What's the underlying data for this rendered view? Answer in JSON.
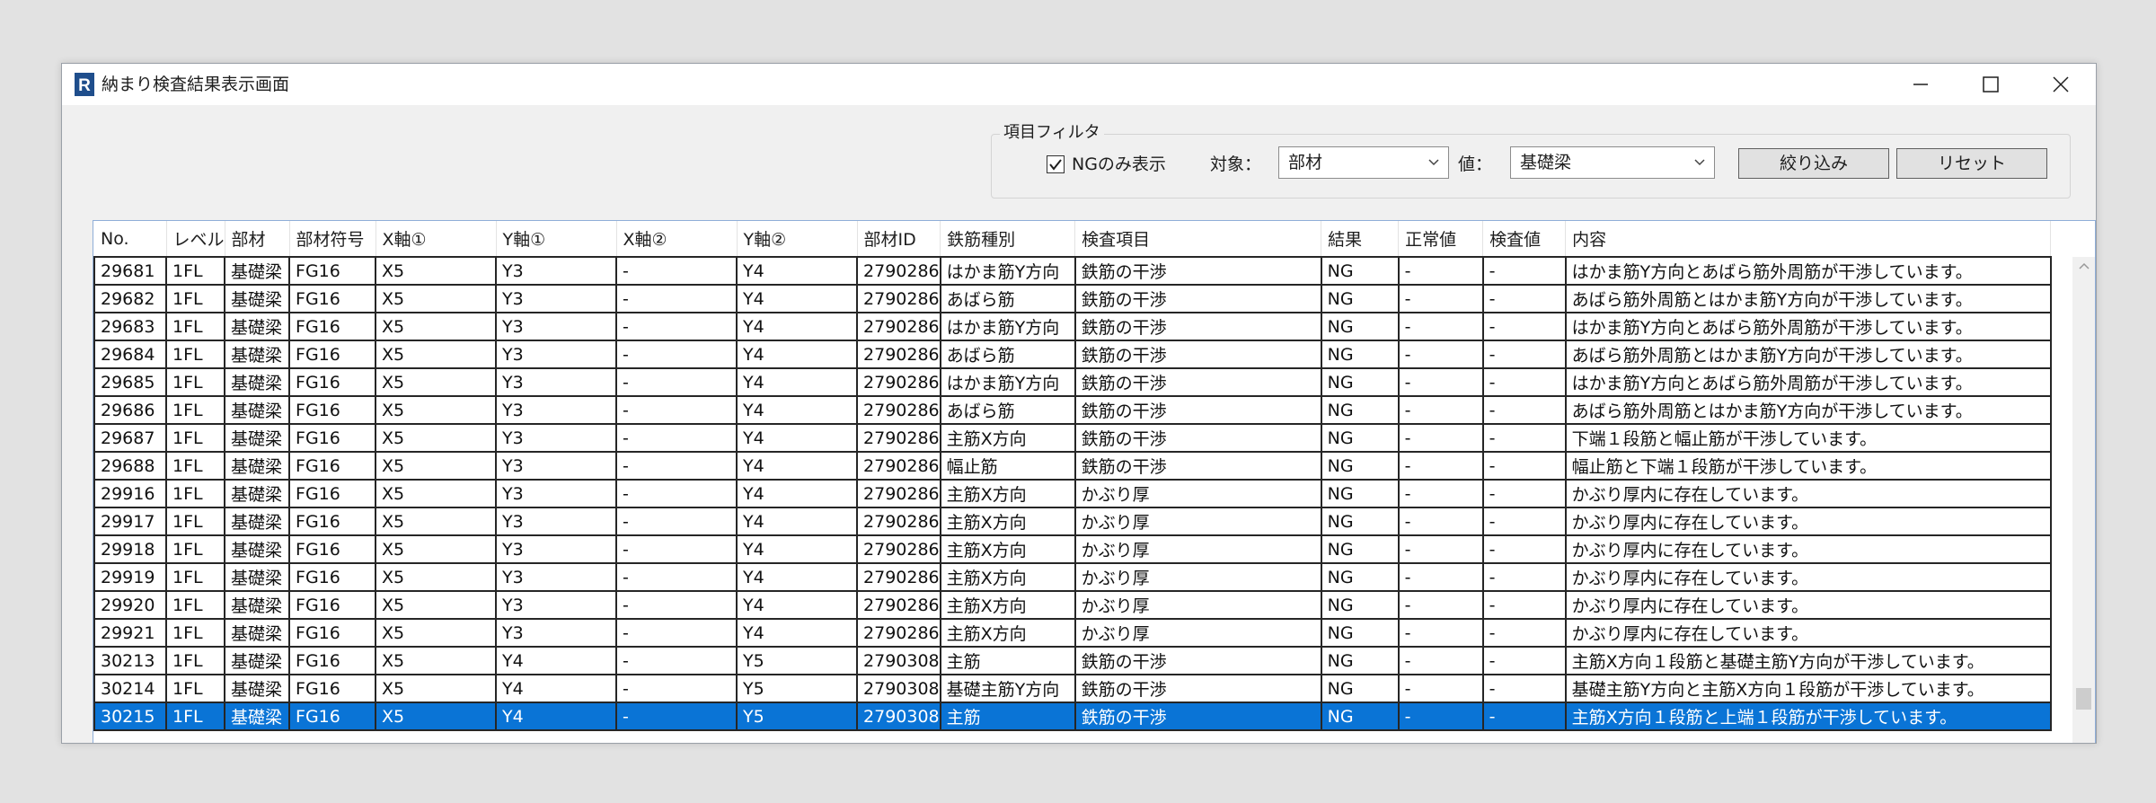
{
  "window": {
    "title": "納まり検査結果表示画面"
  },
  "filter": {
    "legend": "項目フィルタ",
    "ng_only_label": "NGのみ表示",
    "ng_only_checked": true,
    "target_label": "対象：",
    "target_value": "部材",
    "value_label": "値：",
    "value_value": "基礎梁",
    "apply_label": "絞り込み",
    "reset_label": "リセット"
  },
  "table": {
    "columns": [
      "No.",
      "レベル",
      "部材",
      "部材符号",
      "X軸①",
      "Y軸①",
      "X軸②",
      "Y軸②",
      "部材ID",
      "鉄筋種別",
      "検査項目",
      "結果",
      "正常値",
      "検査値",
      "内容"
    ],
    "rows": [
      [
        "29681",
        "1FL",
        "基礎梁",
        "FG16",
        "X5",
        "Y3",
        "-",
        "Y4",
        "2790286",
        "はかま筋Y方向",
        "鉄筋の干渉",
        "NG",
        "-",
        "-",
        "はかま筋Y方向とあばら筋外周筋が干渉しています。"
      ],
      [
        "29682",
        "1FL",
        "基礎梁",
        "FG16",
        "X5",
        "Y3",
        "-",
        "Y4",
        "2790286",
        "あばら筋",
        "鉄筋の干渉",
        "NG",
        "-",
        "-",
        "あばら筋外周筋とはかま筋Y方向が干渉しています。"
      ],
      [
        "29683",
        "1FL",
        "基礎梁",
        "FG16",
        "X5",
        "Y3",
        "-",
        "Y4",
        "2790286",
        "はかま筋Y方向",
        "鉄筋の干渉",
        "NG",
        "-",
        "-",
        "はかま筋Y方向とあばら筋外周筋が干渉しています。"
      ],
      [
        "29684",
        "1FL",
        "基礎梁",
        "FG16",
        "X5",
        "Y3",
        "-",
        "Y4",
        "2790286",
        "あばら筋",
        "鉄筋の干渉",
        "NG",
        "-",
        "-",
        "あばら筋外周筋とはかま筋Y方向が干渉しています。"
      ],
      [
        "29685",
        "1FL",
        "基礎梁",
        "FG16",
        "X5",
        "Y3",
        "-",
        "Y4",
        "2790286",
        "はかま筋Y方向",
        "鉄筋の干渉",
        "NG",
        "-",
        "-",
        "はかま筋Y方向とあばら筋外周筋が干渉しています。"
      ],
      [
        "29686",
        "1FL",
        "基礎梁",
        "FG16",
        "X5",
        "Y3",
        "-",
        "Y4",
        "2790286",
        "あばら筋",
        "鉄筋の干渉",
        "NG",
        "-",
        "-",
        "あばら筋外周筋とはかま筋Y方向が干渉しています。"
      ],
      [
        "29687",
        "1FL",
        "基礎梁",
        "FG16",
        "X5",
        "Y3",
        "-",
        "Y4",
        "2790286",
        "主筋X方向",
        "鉄筋の干渉",
        "NG",
        "-",
        "-",
        "下端１段筋と幅止筋が干渉しています。"
      ],
      [
        "29688",
        "1FL",
        "基礎梁",
        "FG16",
        "X5",
        "Y3",
        "-",
        "Y4",
        "2790286",
        "幅止筋",
        "鉄筋の干渉",
        "NG",
        "-",
        "-",
        "幅止筋と下端１段筋が干渉しています。"
      ],
      [
        "29916",
        "1FL",
        "基礎梁",
        "FG16",
        "X5",
        "Y3",
        "-",
        "Y4",
        "2790286",
        "主筋X方向",
        "かぶり厚",
        "NG",
        "-",
        "-",
        "かぶり厚内に存在しています。"
      ],
      [
        "29917",
        "1FL",
        "基礎梁",
        "FG16",
        "X5",
        "Y3",
        "-",
        "Y4",
        "2790286",
        "主筋X方向",
        "かぶり厚",
        "NG",
        "-",
        "-",
        "かぶり厚内に存在しています。"
      ],
      [
        "29918",
        "1FL",
        "基礎梁",
        "FG16",
        "X5",
        "Y3",
        "-",
        "Y4",
        "2790286",
        "主筋X方向",
        "かぶり厚",
        "NG",
        "-",
        "-",
        "かぶり厚内に存在しています。"
      ],
      [
        "29919",
        "1FL",
        "基礎梁",
        "FG16",
        "X5",
        "Y3",
        "-",
        "Y4",
        "2790286",
        "主筋X方向",
        "かぶり厚",
        "NG",
        "-",
        "-",
        "かぶり厚内に存在しています。"
      ],
      [
        "29920",
        "1FL",
        "基礎梁",
        "FG16",
        "X5",
        "Y3",
        "-",
        "Y4",
        "2790286",
        "主筋X方向",
        "かぶり厚",
        "NG",
        "-",
        "-",
        "かぶり厚内に存在しています。"
      ],
      [
        "29921",
        "1FL",
        "基礎梁",
        "FG16",
        "X5",
        "Y3",
        "-",
        "Y4",
        "2790286",
        "主筋X方向",
        "かぶり厚",
        "NG",
        "-",
        "-",
        "かぶり厚内に存在しています。"
      ],
      [
        "30213",
        "1FL",
        "基礎梁",
        "FG16",
        "X5",
        "Y4",
        "-",
        "Y5",
        "2790308",
        "主筋",
        "鉄筋の干渉",
        "NG",
        "-",
        "-",
        "主筋X方向１段筋と基礎主筋Y方向が干渉しています。"
      ],
      [
        "30214",
        "1FL",
        "基礎梁",
        "FG16",
        "X5",
        "Y4",
        "-",
        "Y5",
        "2790308",
        "基礎主筋Y方向",
        "鉄筋の干渉",
        "NG",
        "-",
        "-",
        "基礎主筋Y方向と主筋X方向１段筋が干渉しています。"
      ],
      [
        "30215",
        "1FL",
        "基礎梁",
        "FG16",
        "X5",
        "Y4",
        "-",
        "Y5",
        "2790308",
        "主筋",
        "鉄筋の干渉",
        "NG",
        "-",
        "-",
        "主筋X方向１段筋と上端１段筋が干渉しています。"
      ]
    ],
    "selected_row_index": 16
  },
  "colors": {
    "selection": "#0a74d6",
    "app_icon": "#1f4e8c"
  }
}
